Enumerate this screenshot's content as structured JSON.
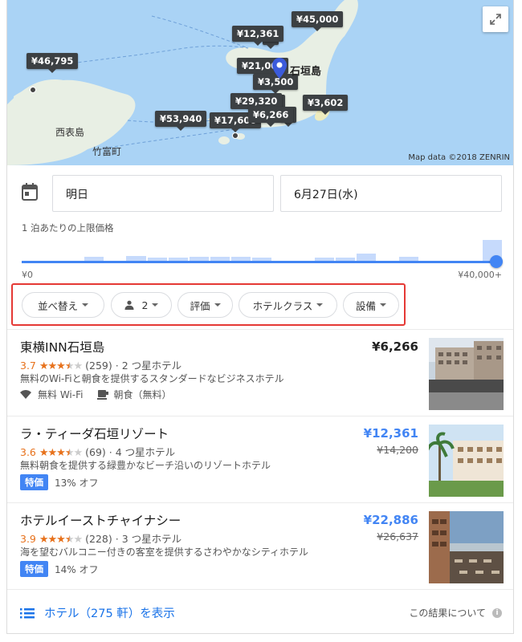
{
  "map": {
    "pins": [
      "¥45,000",
      "¥12,361",
      "0",
      "¥46,795",
      "¥21,000",
      "¥3,500",
      "¥29,320",
      "3",
      "¥3,602",
      "¥53,940",
      "¥17,600",
      "¥6,266",
      "6"
    ],
    "labels": {
      "ishigaki": "石垣島",
      "iriomote": "西表島",
      "taketomi": "竹富町"
    },
    "credit": "Map data ©2018 ZENRIN",
    "expand_icon": "expand-icon"
  },
  "dates": {
    "checkin": "明日",
    "checkout": "6月27日(水)"
  },
  "price_filter": {
    "title": "1 泊あたりの上限価格",
    "min_label": "¥0",
    "max_label": "¥40,000+",
    "slider_value": 1.0,
    "histogram": [
      0,
      0,
      0,
      0.25,
      0,
      0.3,
      0.22,
      0.22,
      0.26,
      0.26,
      0.26,
      0.22,
      0,
      0,
      0.22,
      0.22,
      0.4,
      0,
      0.28,
      0,
      0,
      0,
      0.95
    ]
  },
  "filters": {
    "sort": "並べ替え",
    "guests": "2",
    "rating": "評価",
    "hotel_class": "ホテルクラス",
    "amenities": "設備"
  },
  "hotels": [
    {
      "name": "東横INN石垣島",
      "rating": "3.7",
      "stars_value": 3.7,
      "review_count": "(259)",
      "class": "· 2 つ星ホテル",
      "description": "無料のWi-Fiと朝食を提供するスタンダードなビジネスホテル",
      "amenity_wifi": "無料 Wi-Fi",
      "amenity_breakfast": "朝食（無料）",
      "price": "¥6,266"
    },
    {
      "name": "ラ・ティーダ石垣リゾート",
      "rating": "3.6",
      "stars_value": 3.6,
      "review_count": "(69)",
      "class": "· 4 つ星ホテル",
      "description": "無料朝食を提供する緑豊かなビーチ沿いのリゾートホテル",
      "badge": "特価",
      "discount": "13% オフ",
      "price": "¥12,361",
      "original_price": "¥14,200"
    },
    {
      "name": "ホテルイーストチャイナシー",
      "rating": "3.9",
      "stars_value": 3.9,
      "review_count": "(228)",
      "class": "· 3 つ星ホテル",
      "description": "海を望むバルコニー付きの客室を提供するさわやかなシティホテル",
      "badge": "特価",
      "discount": "14% オフ",
      "price": "¥22,886",
      "original_price": "¥26,637"
    }
  ],
  "footer": {
    "more_link": "ホテル（275 軒）を表示",
    "about": "この結果について"
  },
  "colors": {
    "accent": "#4285f4",
    "star": "#e7711b",
    "highlight_border": "#e53935",
    "pin_bg": "#3c4043"
  }
}
